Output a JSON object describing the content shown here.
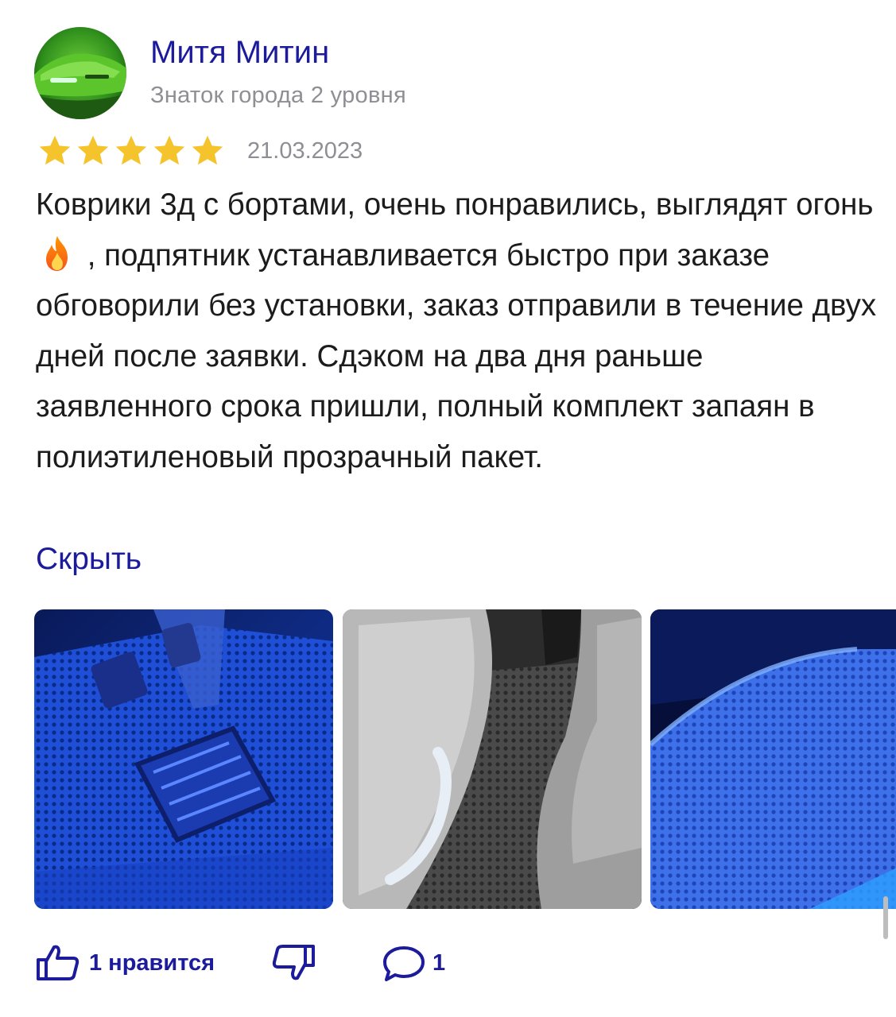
{
  "review": {
    "author": {
      "name": "Митя Митин",
      "level": "Знаток города 2 уровня",
      "avatar_icon": "green-car-avatar"
    },
    "rating": 5,
    "rating_max": 5,
    "star_color": "#f5c32c",
    "date": "21.03.2023",
    "text": {
      "part1": "Коврики 3д с бортами, очень понравились, выглядят огонь",
      "emoji": "fire-icon",
      "part2": " , подпятник устанавливается быстро при заказе обговорили без установки, заказ отправили в течение двух дней после заявки. Сдэком на два дня раньше заявленного срока пришли, полный комплект запаян в полиэтиленовый прозрачный пакет."
    },
    "hide_label": "Скрыть",
    "accent_color": "#1b1b9c",
    "photos": [
      {
        "id": "photo-1",
        "subject": "blue-lit-floor-mat-pedals"
      },
      {
        "id": "photo-2",
        "subject": "grey-rear-floor-mat"
      },
      {
        "id": "photo-3",
        "subject": "blue-lit-floor-mat"
      }
    ],
    "actions": {
      "like_label": "1 нравится",
      "like_icon": "thumbs-up-icon",
      "dislike_icon": "thumbs-down-icon",
      "comment_icon": "comment-icon",
      "comment_count": "1"
    }
  }
}
